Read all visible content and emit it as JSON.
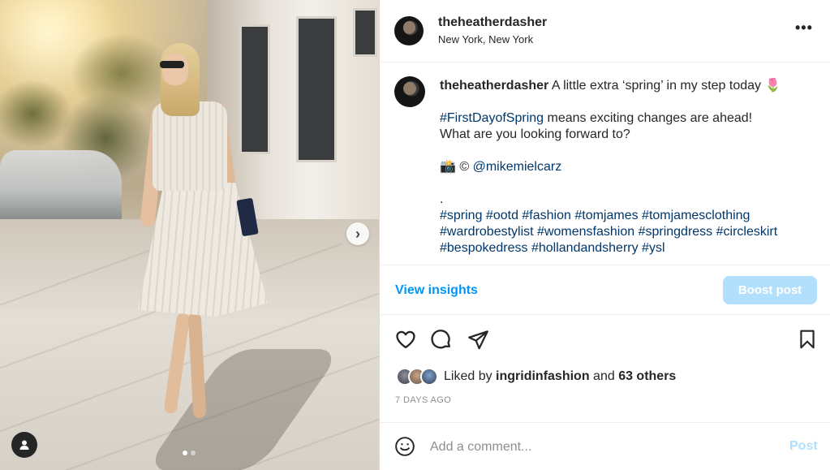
{
  "post": {
    "username": "theheatherdasher",
    "location": "New York, New York",
    "more_label": "•••"
  },
  "caption": {
    "username": "theheatherdasher",
    "text": "A little extra ‘spring’ in my step today 🌷",
    "line2_tag": "#FirstDayofSpring",
    "line2_rest": " means exciting changes are ahead!",
    "line3": "What are you looking forward to?",
    "credit_prefix": "📸 ©",
    "credit_mention": "@mikemielcarz",
    "dot": ".",
    "hashtags_line1": "#spring #ootd #fashion #tomjames #tomjamesclothing",
    "hashtags_line2": "#wardrobestylist #womensfashion #springdress #circleskirt",
    "hashtags_line3": "#bespokedress #hollandandsherry #ysl"
  },
  "insights": {
    "view_label": "View insights",
    "boost_label": "Boost post"
  },
  "icons": [
    "heart-icon",
    "comment-icon",
    "share-icon",
    "bookmark-icon",
    "emoji-icon",
    "tag-user-icon",
    "chevron-right-icon",
    "more-icon"
  ],
  "likes": {
    "prefix": "Liked by ",
    "user": "ingridinfashion",
    "middle": " and ",
    "others": "63 others"
  },
  "date": "7 DAYS AGO",
  "comment": {
    "placeholder": "Add a comment...",
    "post_label": "Post"
  },
  "carousel": {
    "next_label": "›",
    "slide_count": 2,
    "active_slide": 1
  },
  "colors": {
    "link_blue": "#0095f6",
    "hashtag_blue": "#00376b",
    "disabled_blue": "#b2dffc",
    "text": "#262626",
    "muted": "#8e8e8e"
  }
}
